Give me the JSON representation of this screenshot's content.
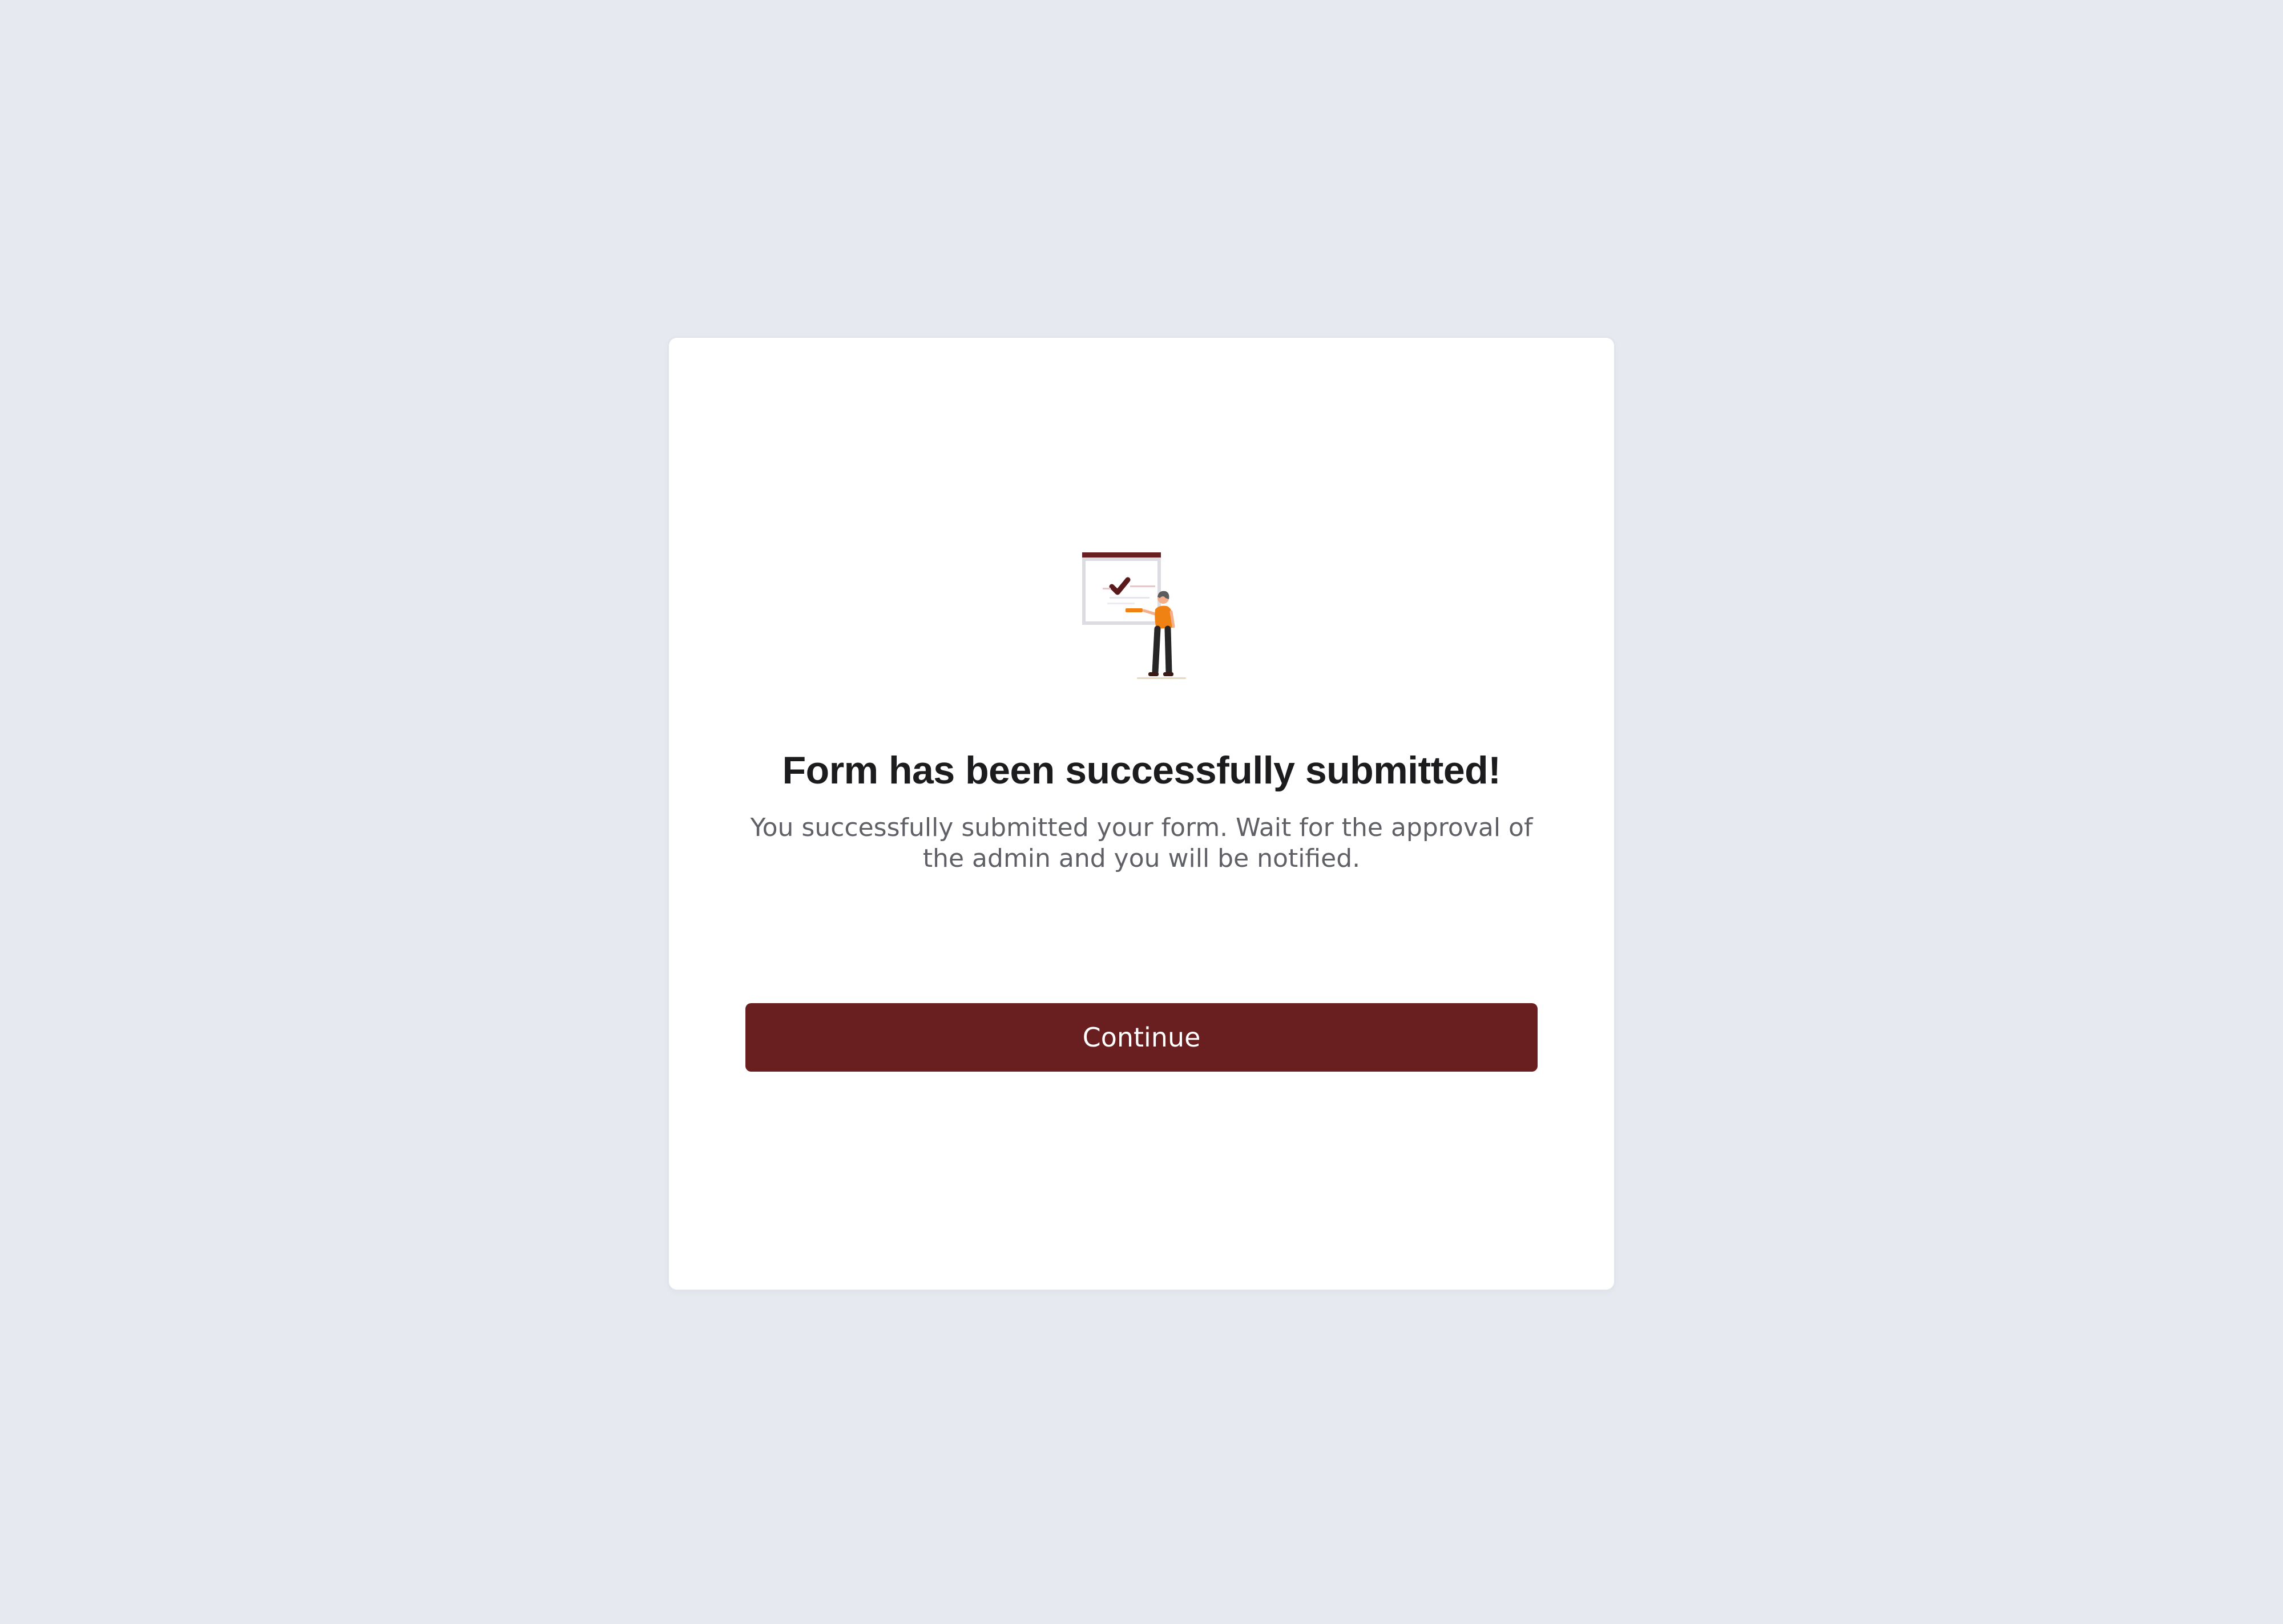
{
  "success_card": {
    "illustration": "form-submitted-illustration",
    "title": "Form has been successfully submitted!",
    "message": "You successfully submitted your form. Wait for the approval of the admin and you will be notified.",
    "continue_label": "Continue"
  },
  "colors": {
    "page_background": "#e6e9f0",
    "card_background": "#ffffff",
    "accent": "#691e1f",
    "illustration_orange": "#f08214",
    "title_text": "#1c1c1e",
    "body_text": "#5f6166"
  }
}
